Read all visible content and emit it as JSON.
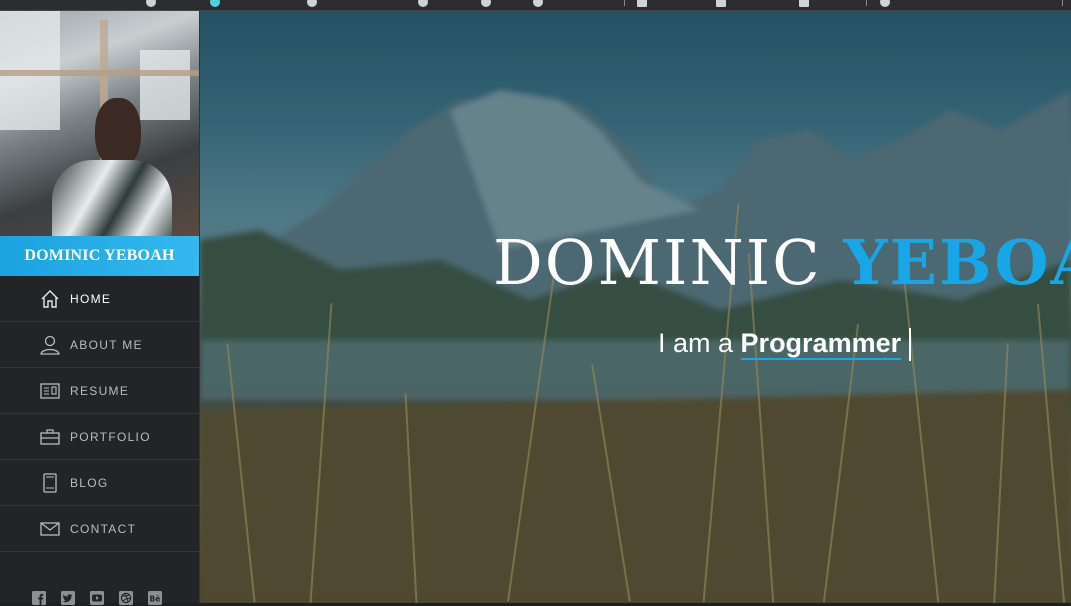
{
  "sidebar": {
    "name": "DOMINIC YEBOAH",
    "nav": [
      {
        "label": "HOME",
        "icon": "home-icon",
        "active": true
      },
      {
        "label": "ABOUT ME",
        "icon": "user-icon",
        "active": false
      },
      {
        "label": "RESUME",
        "icon": "resume-icon",
        "active": false
      },
      {
        "label": "PORTFOLIO",
        "icon": "briefcase-icon",
        "active": false
      },
      {
        "label": "BLOG",
        "icon": "book-icon",
        "active": false
      },
      {
        "label": "CONTACT",
        "icon": "envelope-icon",
        "active": false
      }
    ],
    "social": [
      "facebook-icon",
      "twitter-icon",
      "youtube-icon",
      "dribbble-icon",
      "behance-icon"
    ]
  },
  "hero": {
    "first_name": "DOMINIC",
    "last_name": "YEBOAH",
    "prefix": "I am a",
    "typed": "Programmer"
  },
  "colors": {
    "accent": "#17a6e6",
    "sidebar_bg": "#232427",
    "divider": "#34363a"
  }
}
